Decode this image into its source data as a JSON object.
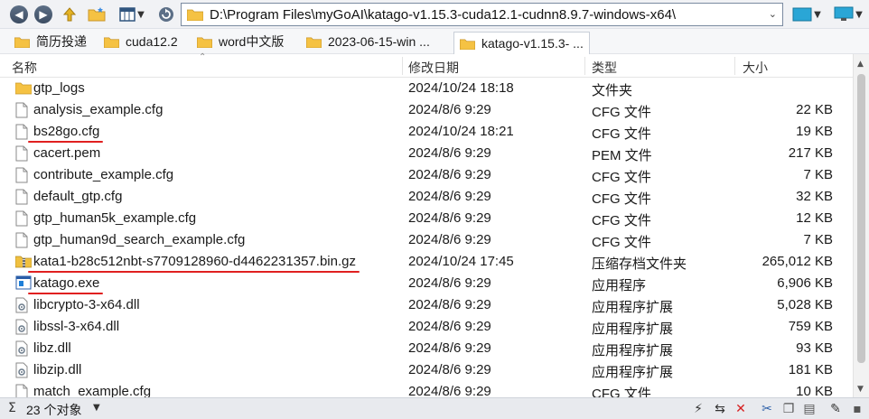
{
  "toolbar": {
    "path": "D:\\Program Files\\myGoAI\\katago-v1.15.3-cuda12.1-cudnn8.9.7-windows-x64\\",
    "icons": [
      "back-icon",
      "forward-icon",
      "up-icon",
      "new-folder-icon",
      "view-icon",
      "refresh-icon",
      "layout-icon",
      "monitor-icon"
    ]
  },
  "bookmarks": [
    {
      "label": "简历投递"
    },
    {
      "label": "cuda12.2"
    },
    {
      "label": "word中文版"
    },
    {
      "label": "2023-06-15-win ..."
    },
    {
      "label": "katago-v1.15.3- ..."
    }
  ],
  "columns": {
    "name": "名称",
    "date": "修改日期",
    "type": "类型",
    "size": "大小"
  },
  "files": [
    {
      "name": "gtp_logs",
      "date": "2024/10/24 18:18",
      "type": "文件夹",
      "size": "",
      "icon": "folder-icon"
    },
    {
      "name": "analysis_example.cfg",
      "date": "2024/8/6 9:29",
      "type": "CFG 文件",
      "size": "22 KB",
      "icon": "file-icon"
    },
    {
      "name": "bs28go.cfg",
      "date": "2024/10/24 18:21",
      "type": "CFG 文件",
      "size": "19 KB",
      "icon": "file-icon"
    },
    {
      "name": "cacert.pem",
      "date": "2024/8/6 9:29",
      "type": "PEM 文件",
      "size": "217 KB",
      "icon": "file-icon"
    },
    {
      "name": "contribute_example.cfg",
      "date": "2024/8/6 9:29",
      "type": "CFG 文件",
      "size": "7 KB",
      "icon": "file-icon"
    },
    {
      "name": "default_gtp.cfg",
      "date": "2024/8/6 9:29",
      "type": "CFG 文件",
      "size": "32 KB",
      "icon": "file-icon"
    },
    {
      "name": "gtp_human5k_example.cfg",
      "date": "2024/8/6 9:29",
      "type": "CFG 文件",
      "size": "12 KB",
      "icon": "file-icon"
    },
    {
      "name": "gtp_human9d_search_example.cfg",
      "date": "2024/8/6 9:29",
      "type": "CFG 文件",
      "size": "7 KB",
      "icon": "file-icon"
    },
    {
      "name": "kata1-b28c512nbt-s7709128960-d4462231357.bin.gz",
      "date": "2024/10/24 17:45",
      "type": "压缩存档文件夹",
      "size": "265,012 KB",
      "icon": "zip-folder-icon"
    },
    {
      "name": "katago.exe",
      "date": "2024/8/6 9:29",
      "type": "应用程序",
      "size": "6,906 KB",
      "icon": "exe-icon"
    },
    {
      "name": "libcrypto-3-x64.dll",
      "date": "2024/8/6 9:29",
      "type": "应用程序扩展",
      "size": "5,028 KB",
      "icon": "dll-icon"
    },
    {
      "name": "libssl-3-x64.dll",
      "date": "2024/8/6 9:29",
      "type": "应用程序扩展",
      "size": "759 KB",
      "icon": "dll-icon"
    },
    {
      "name": "libz.dll",
      "date": "2024/8/6 9:29",
      "type": "应用程序扩展",
      "size": "93 KB",
      "icon": "dll-icon"
    },
    {
      "name": "libzip.dll",
      "date": "2024/8/6 9:29",
      "type": "应用程序扩展",
      "size": "181 KB",
      "icon": "dll-icon"
    },
    {
      "name": "match_example.cfg",
      "date": "2024/8/6 9:29",
      "type": "CFG 文件",
      "size": "10 KB",
      "icon": "file-icon"
    }
  ],
  "annotations": {
    "underline_color": "#e02020",
    "underlined_files": [
      "bs28go.cfg",
      "kata1-b28c512nbt-s7709128960-d4462231357.bin.gz",
      "katago.exe"
    ]
  },
  "status": {
    "sigma": "Σ",
    "count": "23 个对象"
  },
  "colors": {
    "folder": "#f5c243",
    "accent": "#1e7fd8",
    "toolbar_bg": "#f1f2f5"
  }
}
